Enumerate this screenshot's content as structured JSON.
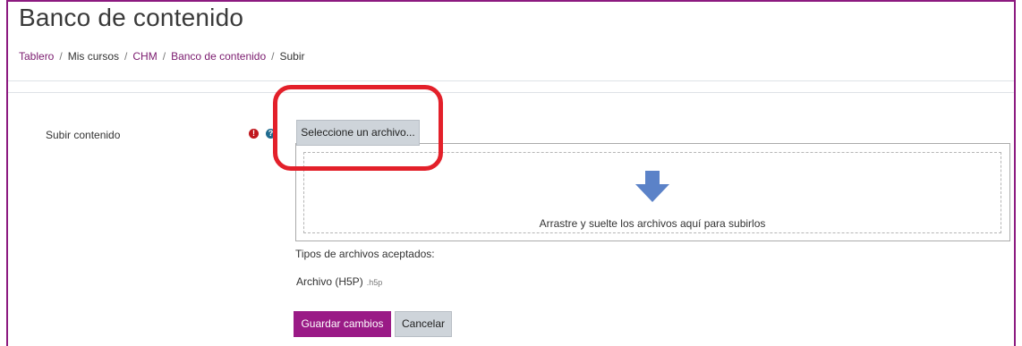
{
  "header": {
    "title": "Banco de contenido"
  },
  "breadcrumb": {
    "items": [
      {
        "label": "Tablero",
        "link": true
      },
      {
        "label": "Mis cursos",
        "link": false
      },
      {
        "label": "CHM",
        "link": true
      },
      {
        "label": "Banco de contenido",
        "link": true
      },
      {
        "label": "Subir",
        "link": false
      }
    ],
    "separator": "/"
  },
  "form": {
    "upload_label": "Subir contenido",
    "required_icon": "exclamation-circle-icon",
    "help_icon": "question-circle-icon",
    "select_button_label": "Seleccione un archivo...",
    "dropzone_text": "Arrastre y suelte los archivos aquí para subirlos",
    "accepted_types_label": "Tipos de archivos aceptados:",
    "accepted_types": [
      {
        "name": "Archivo (H5P)",
        "ext": ".h5p"
      }
    ],
    "save_label": "Guardar cambios",
    "cancel_label": "Cancelar"
  },
  "colors": {
    "brand": "#9a1a86",
    "link": "#7a1a6e",
    "annotation": "#e3202a",
    "arrow": "#5b82c8"
  }
}
